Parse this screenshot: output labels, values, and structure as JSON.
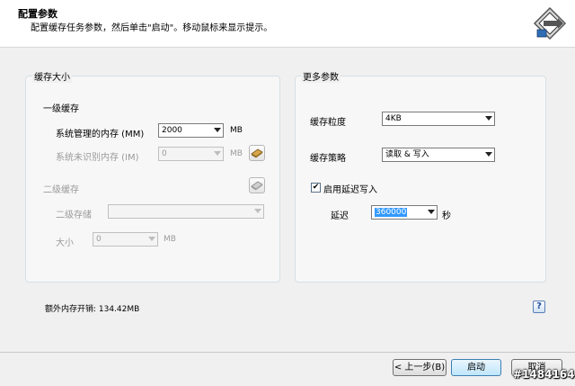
{
  "header": {
    "title": "配置参数",
    "subtitle": "配置缓存任务参数，然后单击\"启动\"。移动鼠标来显示提示。"
  },
  "cache_size": {
    "title": "缓存大小",
    "l1": {
      "label": "一级缓存",
      "managed_label": "系统管理的内存 (MM)",
      "managed_value": "2000",
      "managed_unit": "MB",
      "unmanaged_label": "系统未识别内存 (IM)",
      "unmanaged_value": "0",
      "unmanaged_unit": "MB"
    },
    "l2": {
      "label": "二级缓存",
      "storage_label": "二级存储",
      "storage_value": "",
      "size_label": "大小",
      "size_value": "0",
      "size_unit": "MB"
    }
  },
  "more_params": {
    "title": "更多参数",
    "granularity_label": "缓存粒度",
    "granularity_value": "4KB",
    "policy_label": "缓存策略",
    "policy_value": "读取 & 写入",
    "lazy_write_label": "启用延迟写入",
    "lazy_write_checked": true,
    "delay_label": "延迟",
    "delay_value": "360000",
    "delay_unit": "秒"
  },
  "extra_memory": "额外内存开销: 134.42MB",
  "help_label": "?",
  "buttons": {
    "back": "< 上一步(B)",
    "start": "启动",
    "cancel": "取消"
  },
  "watermark": "#1484164"
}
